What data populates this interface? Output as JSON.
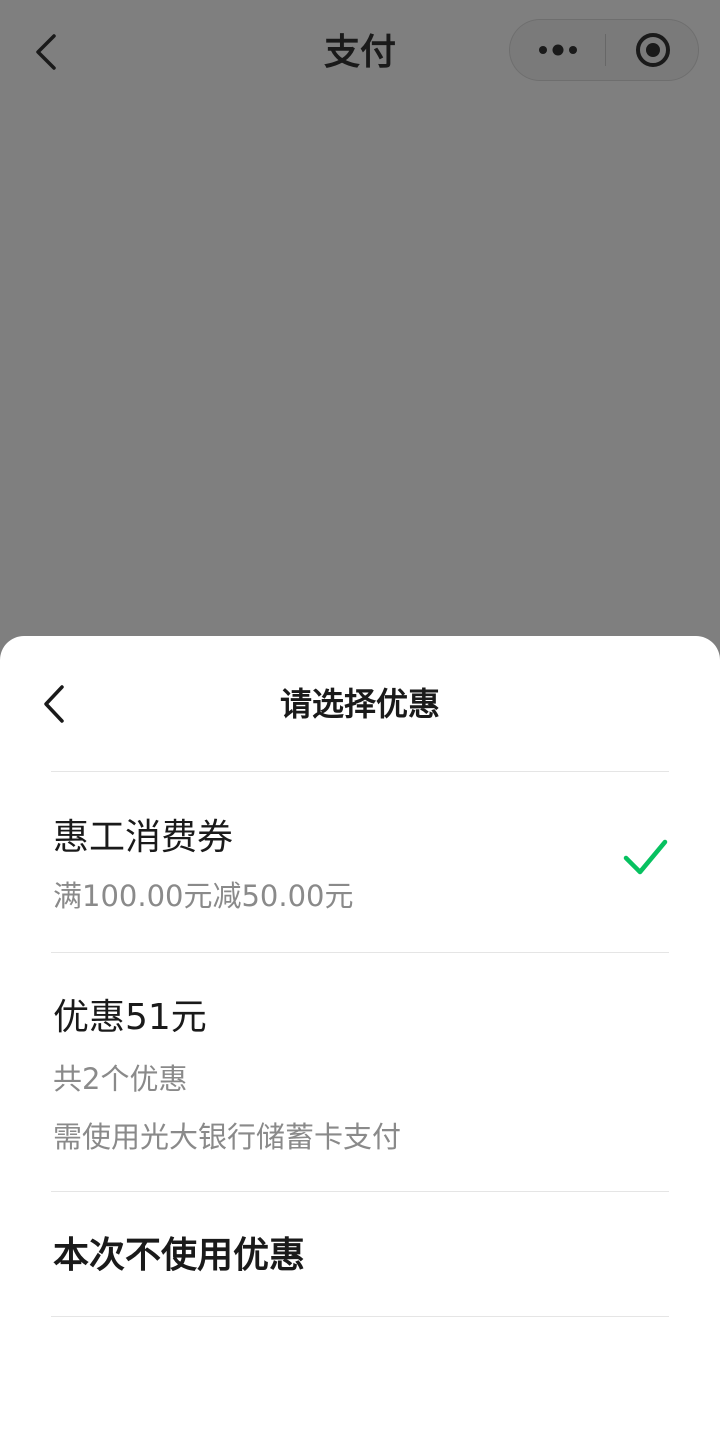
{
  "navbar": {
    "title": "支付",
    "back_icon": "chevron-left-icon",
    "more_icon": "more-dots-icon",
    "close_icon": "record-circle-icon"
  },
  "sheet": {
    "title": "请选择优惠",
    "back_icon": "chevron-left-icon",
    "options": [
      {
        "title": "惠工消费券",
        "lines": [
          "满100.00元减50.00元"
        ],
        "selected": true
      },
      {
        "title": "优惠51元",
        "lines": [
          "共2个优惠",
          "需使用光大银行储蓄卡支付"
        ],
        "selected": false
      },
      {
        "title": "本次不使用优惠",
        "lines": [],
        "selected": false
      }
    ]
  },
  "colors": {
    "overlay": "#7f7f7f",
    "check": "#07c160",
    "primary_text": "#1a1a1a",
    "secondary_text": "#8a8a8a",
    "divider": "#e5e5e5"
  }
}
